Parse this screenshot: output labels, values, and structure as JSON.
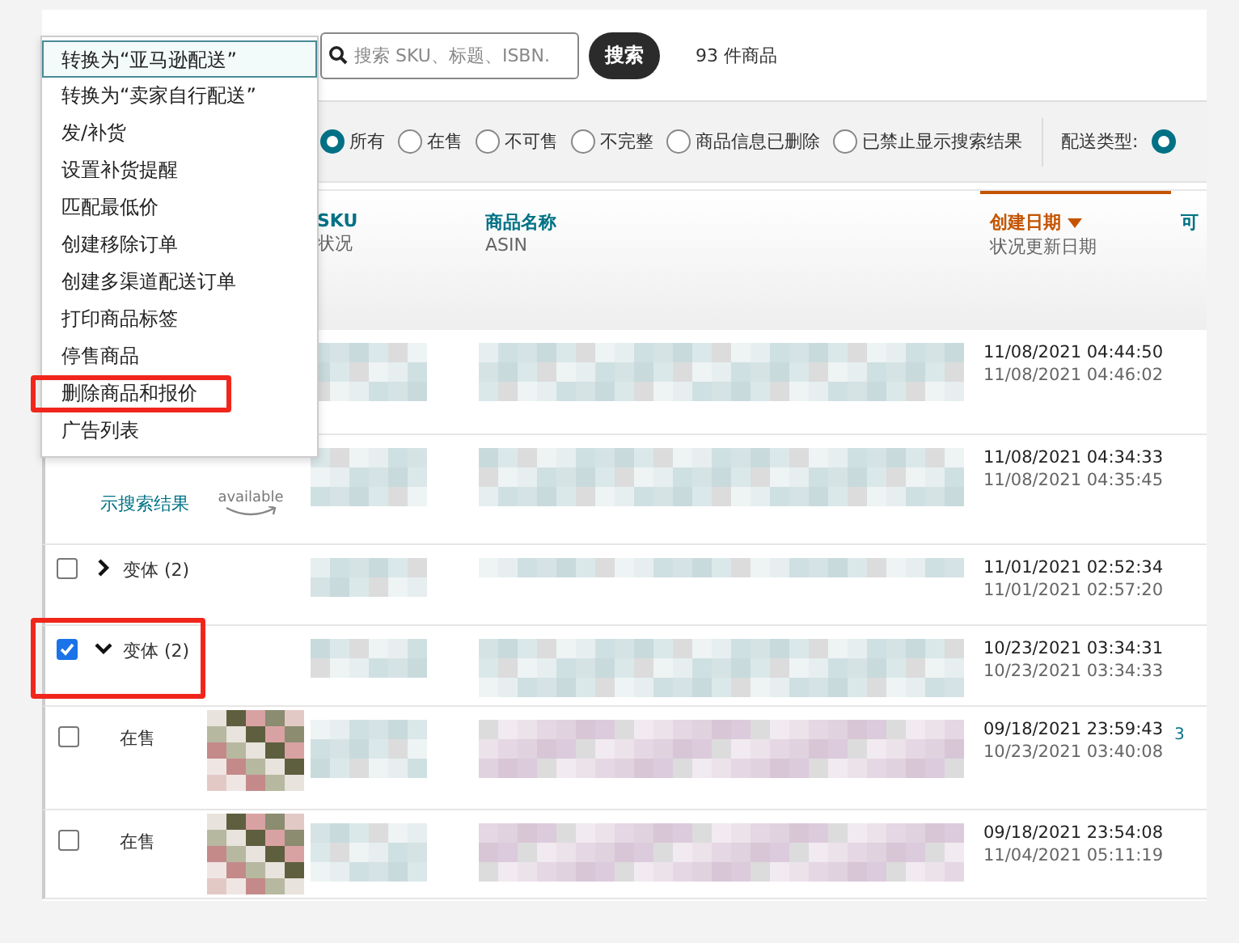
{
  "menu": {
    "items": [
      {
        "label": "转换为“亚马逊配送”",
        "focused": true,
        "highlighted": false
      },
      {
        "label": "转换为“卖家自行配送”",
        "focused": false,
        "highlighted": false
      },
      {
        "label": "发/补货",
        "focused": false,
        "highlighted": false
      },
      {
        "label": "设置补货提醒",
        "focused": false,
        "highlighted": false
      },
      {
        "label": "匹配最低价",
        "focused": false,
        "highlighted": false
      },
      {
        "label": "创建移除订单",
        "focused": false,
        "highlighted": false
      },
      {
        "label": "创建多渠道配送订单",
        "focused": false,
        "highlighted": false
      },
      {
        "label": "打印商品标签",
        "focused": false,
        "highlighted": false
      },
      {
        "label": "停售商品",
        "focused": false,
        "highlighted": false
      },
      {
        "label": "删除商品和报价",
        "focused": false,
        "highlighted": true
      },
      {
        "label": "广告列表",
        "focused": false,
        "highlighted": false
      }
    ]
  },
  "search": {
    "placeholder": "搜索 SKU、标题、ISBN.",
    "button": "搜索"
  },
  "result_count": "93 件商品",
  "filters": {
    "options": [
      {
        "label": "所有",
        "selected": true
      },
      {
        "label": "在售",
        "selected": false
      },
      {
        "label": "不可售",
        "selected": false
      },
      {
        "label": "不完整",
        "selected": false
      },
      {
        "label": "商品信息已删除",
        "selected": false
      },
      {
        "label": "已禁止显示搜索结果",
        "selected": false
      }
    ],
    "delivery": {
      "label": "配送类型:",
      "selected": true
    }
  },
  "table": {
    "columns": [
      {
        "title": "SKU",
        "subtitle": "状况",
        "sorted": false
      },
      {
        "title": "商品名称",
        "subtitle": "ASIN",
        "sorted": false
      },
      {
        "title": "创建日期",
        "subtitle": "状况更新日期",
        "sorted": true
      },
      {
        "title": "可",
        "sorted": false
      }
    ],
    "rows": [
      {
        "kind": "plain",
        "created": "11/08/2021 04:44:50",
        "updated": "11/08/2021 04:46:02"
      },
      {
        "kind": "no-image",
        "status_link": "示搜索结果",
        "image_text": "available",
        "created": "11/08/2021 04:34:33",
        "updated": "11/08/2021 04:35:45"
      },
      {
        "kind": "variant",
        "checked": false,
        "expanded": false,
        "highlighted": false,
        "label": "变体 (2)",
        "created": "11/01/2021 02:52:34",
        "updated": "11/01/2021 02:57:20"
      },
      {
        "kind": "variant",
        "checked": true,
        "expanded": true,
        "highlighted": true,
        "label": "变体 (2)",
        "created": "10/23/2021 03:34:31",
        "updated": "10/23/2021 03:34:33"
      },
      {
        "kind": "photo",
        "checked": false,
        "status": "在售",
        "created": "09/18/2021 23:59:43",
        "updated": "10/23/2021 03:40:08",
        "column_5": "3"
      },
      {
        "kind": "photo",
        "checked": false,
        "status": "在售",
        "created": "09/18/2021 23:54:08",
        "updated": "11/04/2021 05:11:19"
      }
    ]
  }
}
